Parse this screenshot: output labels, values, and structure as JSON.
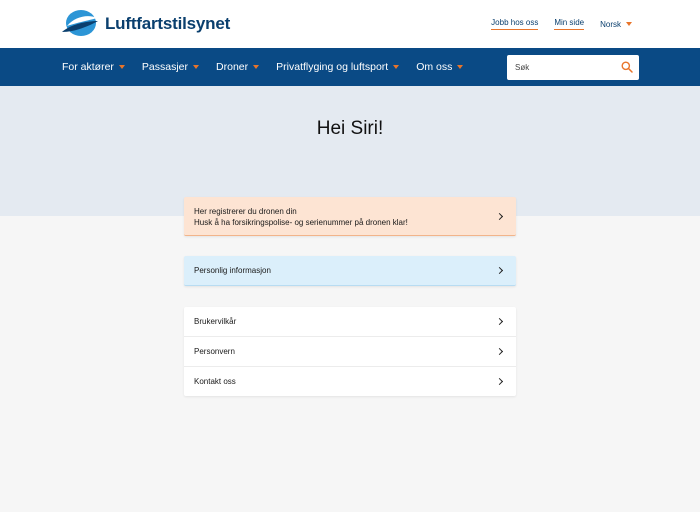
{
  "header": {
    "brand": "Luftfartstilsynet",
    "links": [
      "Jobb hos oss",
      "Min side"
    ],
    "language": "Norsk"
  },
  "nav": {
    "items": [
      "For aktører",
      "Passasjer",
      "Droner",
      "Privatflyging og luftsport",
      "Om oss"
    ],
    "search_placeholder": "Søk"
  },
  "hero": {
    "title": "Hei Siri!"
  },
  "cards": {
    "drone": {
      "line1": "Her registrerer du dronen din",
      "line2": "Husk å ha forsikringspolise- og serienummer på dronen klar!"
    },
    "personal": "Personlig informasjon",
    "links": [
      "Brukervilkår",
      "Personvern",
      "Kontakt oss"
    ]
  },
  "colors": {
    "brand_blue": "#0a4a85",
    "accent_orange": "#e8742a",
    "hero_bg": "#e4eaf1",
    "drone_card_bg": "#fde4d3",
    "info_card_bg": "#dbeffb"
  },
  "icons": [
    "logo-mark",
    "chevron-down-icon",
    "search-icon",
    "chevron-right-icon"
  ]
}
